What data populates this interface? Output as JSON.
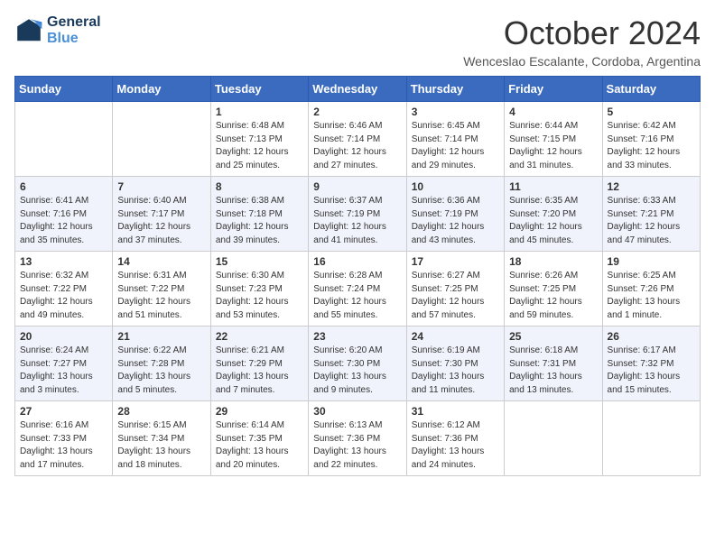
{
  "header": {
    "logo_line1": "General",
    "logo_line2": "Blue",
    "month_title": "October 2024",
    "location": "Wenceslao Escalante, Cordoba, Argentina"
  },
  "weekdays": [
    "Sunday",
    "Monday",
    "Tuesday",
    "Wednesday",
    "Thursday",
    "Friday",
    "Saturday"
  ],
  "weeks": [
    [
      {
        "day": "",
        "info": ""
      },
      {
        "day": "",
        "info": ""
      },
      {
        "day": "1",
        "info": "Sunrise: 6:48 AM\nSunset: 7:13 PM\nDaylight: 12 hours and 25 minutes."
      },
      {
        "day": "2",
        "info": "Sunrise: 6:46 AM\nSunset: 7:14 PM\nDaylight: 12 hours and 27 minutes."
      },
      {
        "day": "3",
        "info": "Sunrise: 6:45 AM\nSunset: 7:14 PM\nDaylight: 12 hours and 29 minutes."
      },
      {
        "day": "4",
        "info": "Sunrise: 6:44 AM\nSunset: 7:15 PM\nDaylight: 12 hours and 31 minutes."
      },
      {
        "day": "5",
        "info": "Sunrise: 6:42 AM\nSunset: 7:16 PM\nDaylight: 12 hours and 33 minutes."
      }
    ],
    [
      {
        "day": "6",
        "info": "Sunrise: 6:41 AM\nSunset: 7:16 PM\nDaylight: 12 hours and 35 minutes."
      },
      {
        "day": "7",
        "info": "Sunrise: 6:40 AM\nSunset: 7:17 PM\nDaylight: 12 hours and 37 minutes."
      },
      {
        "day": "8",
        "info": "Sunrise: 6:38 AM\nSunset: 7:18 PM\nDaylight: 12 hours and 39 minutes."
      },
      {
        "day": "9",
        "info": "Sunrise: 6:37 AM\nSunset: 7:19 PM\nDaylight: 12 hours and 41 minutes."
      },
      {
        "day": "10",
        "info": "Sunrise: 6:36 AM\nSunset: 7:19 PM\nDaylight: 12 hours and 43 minutes."
      },
      {
        "day": "11",
        "info": "Sunrise: 6:35 AM\nSunset: 7:20 PM\nDaylight: 12 hours and 45 minutes."
      },
      {
        "day": "12",
        "info": "Sunrise: 6:33 AM\nSunset: 7:21 PM\nDaylight: 12 hours and 47 minutes."
      }
    ],
    [
      {
        "day": "13",
        "info": "Sunrise: 6:32 AM\nSunset: 7:22 PM\nDaylight: 12 hours and 49 minutes."
      },
      {
        "day": "14",
        "info": "Sunrise: 6:31 AM\nSunset: 7:22 PM\nDaylight: 12 hours and 51 minutes."
      },
      {
        "day": "15",
        "info": "Sunrise: 6:30 AM\nSunset: 7:23 PM\nDaylight: 12 hours and 53 minutes."
      },
      {
        "day": "16",
        "info": "Sunrise: 6:28 AM\nSunset: 7:24 PM\nDaylight: 12 hours and 55 minutes."
      },
      {
        "day": "17",
        "info": "Sunrise: 6:27 AM\nSunset: 7:25 PM\nDaylight: 12 hours and 57 minutes."
      },
      {
        "day": "18",
        "info": "Sunrise: 6:26 AM\nSunset: 7:25 PM\nDaylight: 12 hours and 59 minutes."
      },
      {
        "day": "19",
        "info": "Sunrise: 6:25 AM\nSunset: 7:26 PM\nDaylight: 13 hours and 1 minute."
      }
    ],
    [
      {
        "day": "20",
        "info": "Sunrise: 6:24 AM\nSunset: 7:27 PM\nDaylight: 13 hours and 3 minutes."
      },
      {
        "day": "21",
        "info": "Sunrise: 6:22 AM\nSunset: 7:28 PM\nDaylight: 13 hours and 5 minutes."
      },
      {
        "day": "22",
        "info": "Sunrise: 6:21 AM\nSunset: 7:29 PM\nDaylight: 13 hours and 7 minutes."
      },
      {
        "day": "23",
        "info": "Sunrise: 6:20 AM\nSunset: 7:30 PM\nDaylight: 13 hours and 9 minutes."
      },
      {
        "day": "24",
        "info": "Sunrise: 6:19 AM\nSunset: 7:30 PM\nDaylight: 13 hours and 11 minutes."
      },
      {
        "day": "25",
        "info": "Sunrise: 6:18 AM\nSunset: 7:31 PM\nDaylight: 13 hours and 13 minutes."
      },
      {
        "day": "26",
        "info": "Sunrise: 6:17 AM\nSunset: 7:32 PM\nDaylight: 13 hours and 15 minutes."
      }
    ],
    [
      {
        "day": "27",
        "info": "Sunrise: 6:16 AM\nSunset: 7:33 PM\nDaylight: 13 hours and 17 minutes."
      },
      {
        "day": "28",
        "info": "Sunrise: 6:15 AM\nSunset: 7:34 PM\nDaylight: 13 hours and 18 minutes."
      },
      {
        "day": "29",
        "info": "Sunrise: 6:14 AM\nSunset: 7:35 PM\nDaylight: 13 hours and 20 minutes."
      },
      {
        "day": "30",
        "info": "Sunrise: 6:13 AM\nSunset: 7:36 PM\nDaylight: 13 hours and 22 minutes."
      },
      {
        "day": "31",
        "info": "Sunrise: 6:12 AM\nSunset: 7:36 PM\nDaylight: 13 hours and 24 minutes."
      },
      {
        "day": "",
        "info": ""
      },
      {
        "day": "",
        "info": ""
      }
    ]
  ]
}
